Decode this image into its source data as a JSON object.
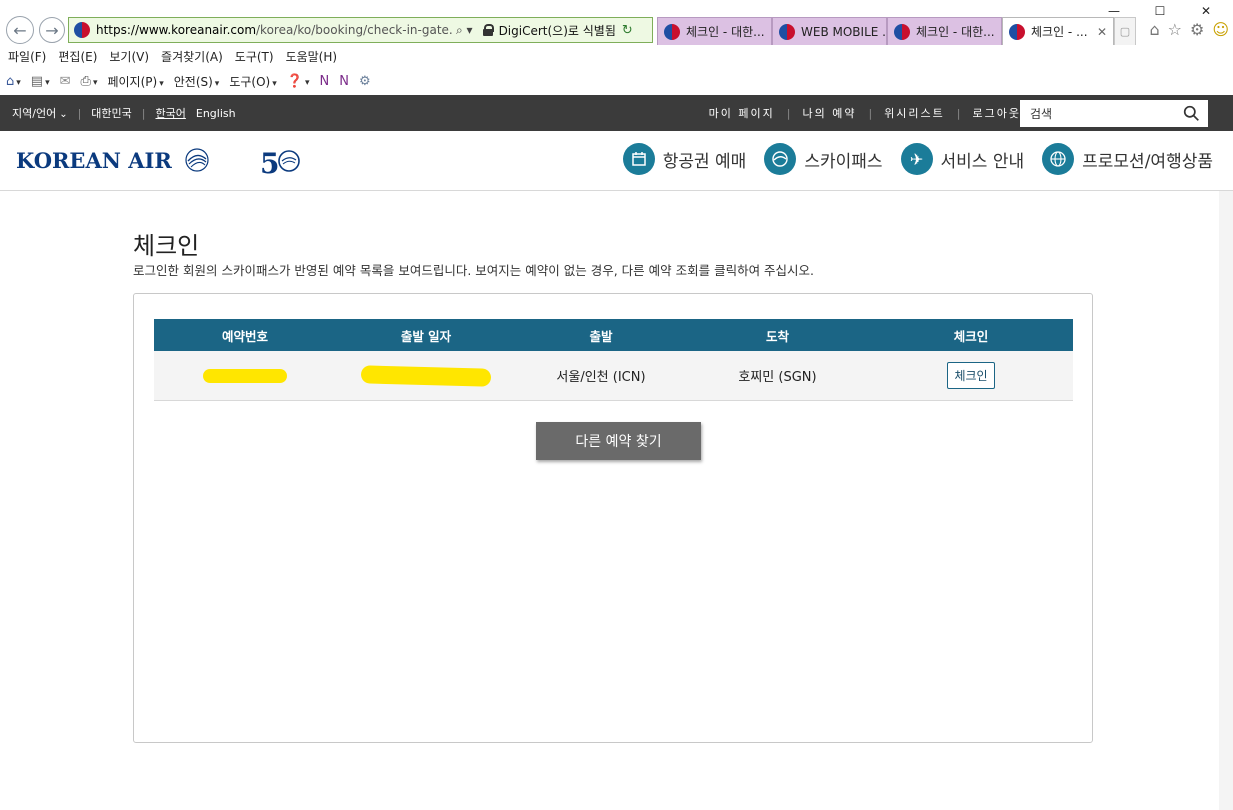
{
  "browser": {
    "url_host": "https://www.koreanair.com",
    "url_path": "/korea/ko/booking/check-in-gate.html",
    "cert_label": "DigiCert(으)로 식별됨",
    "tabs": [
      {
        "label": "체크인 - 대한..."
      },
      {
        "label": "WEB MOBILE ..."
      },
      {
        "label": "체크인 - 대한..."
      },
      {
        "label": "체크인 - ..."
      }
    ],
    "menu": [
      "파일(F)",
      "편집(E)",
      "보기(V)",
      "즐겨찾기(A)",
      "도구(T)",
      "도움말(H)"
    ],
    "commands": {
      "page": "페이지(P)",
      "safety": "안전(S)",
      "tools": "도구(O)"
    }
  },
  "utility": {
    "region_label": "지역/언어",
    "country": "대한민국",
    "lang_ko": "한국어",
    "lang_en": "English",
    "links": [
      "마이 페이지",
      "나의 예약",
      "위시리스트",
      "로그아웃"
    ],
    "search_placeholder": "검색"
  },
  "header": {
    "logo_text": "KOREAN AIR",
    "nav": [
      "항공권 예매",
      "스카이패스",
      "서비스 안내",
      "프로모션/여행상품"
    ]
  },
  "main": {
    "title": "체크인",
    "description": "로그인한 회원의 스카이패스가 반영된 예약 목록을 보여드립니다. 보여지는 예약이 없는 경우, 다른 예약 조회를 클릭하여 주십시오.",
    "table": {
      "headers": [
        "예약번호",
        "출발 일자",
        "출발",
        "도착",
        "체크인"
      ],
      "rows": [
        {
          "departure": "서울/인천 (ICN)",
          "arrival": "호찌민 (SGN)",
          "checkin_label": "체크인"
        }
      ]
    },
    "find_button": "다른 예약 찾기"
  },
  "colors": {
    "brand_teal": "#1b6585",
    "nav_circle": "#1b7c99",
    "utility_bar": "#3b3b3b",
    "redaction": "#ffe600"
  }
}
